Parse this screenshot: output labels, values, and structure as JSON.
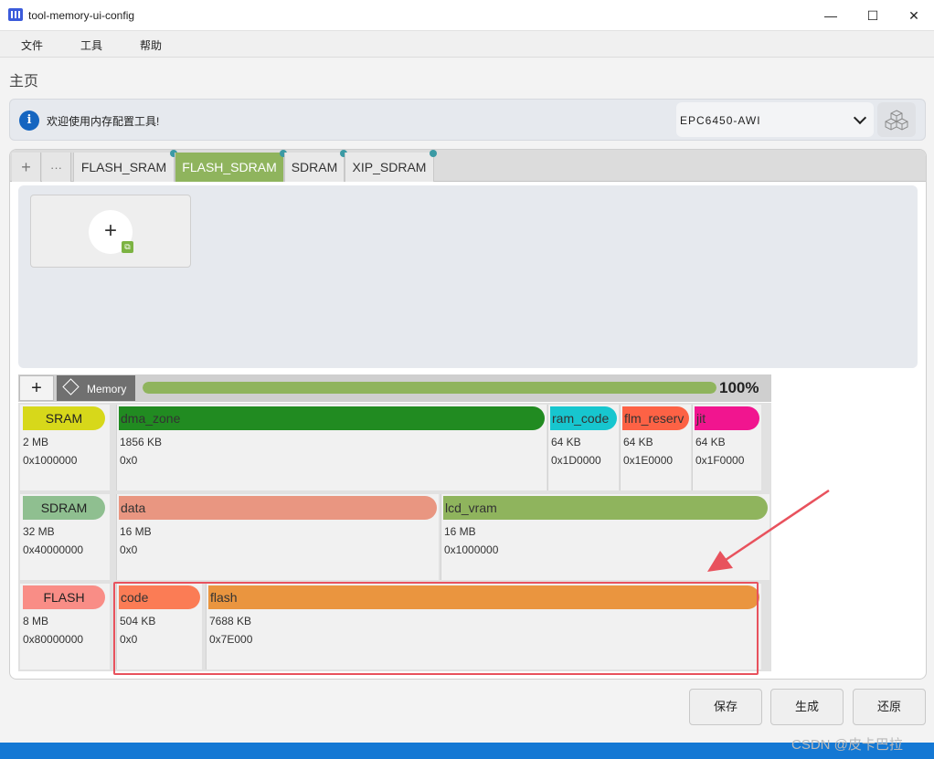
{
  "window": {
    "title": "tool-memory-ui-config",
    "minimize": "—",
    "maximize": "☐",
    "close": "✕"
  },
  "menu": [
    "文件",
    "工具",
    "帮助"
  ],
  "page_title": "主页",
  "info": {
    "icon": "info-icon",
    "text": "欢迎使用内存配置工具!",
    "device": "EPC6450-AWI"
  },
  "tabs": [
    {
      "label": "FLASH_SRAM",
      "active": false
    },
    {
      "label": "FLASH_SDRAM",
      "active": true
    },
    {
      "label": "SDRAM",
      "active": false
    },
    {
      "label": "XIP_SDRAM",
      "active": false
    }
  ],
  "tab_tools": {
    "add": "+",
    "more": "···"
  },
  "add_card": {
    "plus": "+",
    "badge_icon": "external-link-icon"
  },
  "memory_bar": {
    "add": "+",
    "label": "Memory",
    "progress": "100%",
    "progress_value": 1.0
  },
  "regions": [
    {
      "name": "SRAM",
      "size": "2 MB",
      "addr": "0x1000000",
      "color": "#d7d81a",
      "blocks": [
        {
          "name": "dma_zone",
          "size": "1856 KB",
          "addr": "0x0",
          "color": "#218b21"
        },
        {
          "name": "ram_code",
          "size": "64 KB",
          "addr": "0x1D0000",
          "color": "#17c6cf"
        },
        {
          "name": "flm_reserv",
          "size": "64 KB",
          "addr": "0x1E0000",
          "color": "#fd6245"
        },
        {
          "name": "jit",
          "size": "64 KB",
          "addr": "0x1F0000",
          "color": "#f1158f"
        }
      ]
    },
    {
      "name": "SDRAM",
      "size": "32 MB",
      "addr": "0x40000000",
      "color": "#8fbf90",
      "blocks": [
        {
          "name": "data",
          "size": "16 MB",
          "addr": "0x0",
          "color": "#e99681"
        },
        {
          "name": "lcd_vram",
          "size": "16 MB",
          "addr": "0x1000000",
          "color": "#8fb45d"
        }
      ]
    },
    {
      "name": "FLASH",
      "size": "8 MB",
      "addr": "0x80000000",
      "color": "#f98d86",
      "blocks": [
        {
          "name": "code",
          "size": "504 KB",
          "addr": "0x0",
          "color": "#fb7c55"
        },
        {
          "name": "flash",
          "size": "7688 KB",
          "addr": "0x7E000",
          "color": "#ea953f"
        }
      ]
    }
  ],
  "buttons": {
    "save": "保存",
    "generate": "生成",
    "restore": "还原"
  },
  "watermark": "CSDN @皮卡巴拉"
}
